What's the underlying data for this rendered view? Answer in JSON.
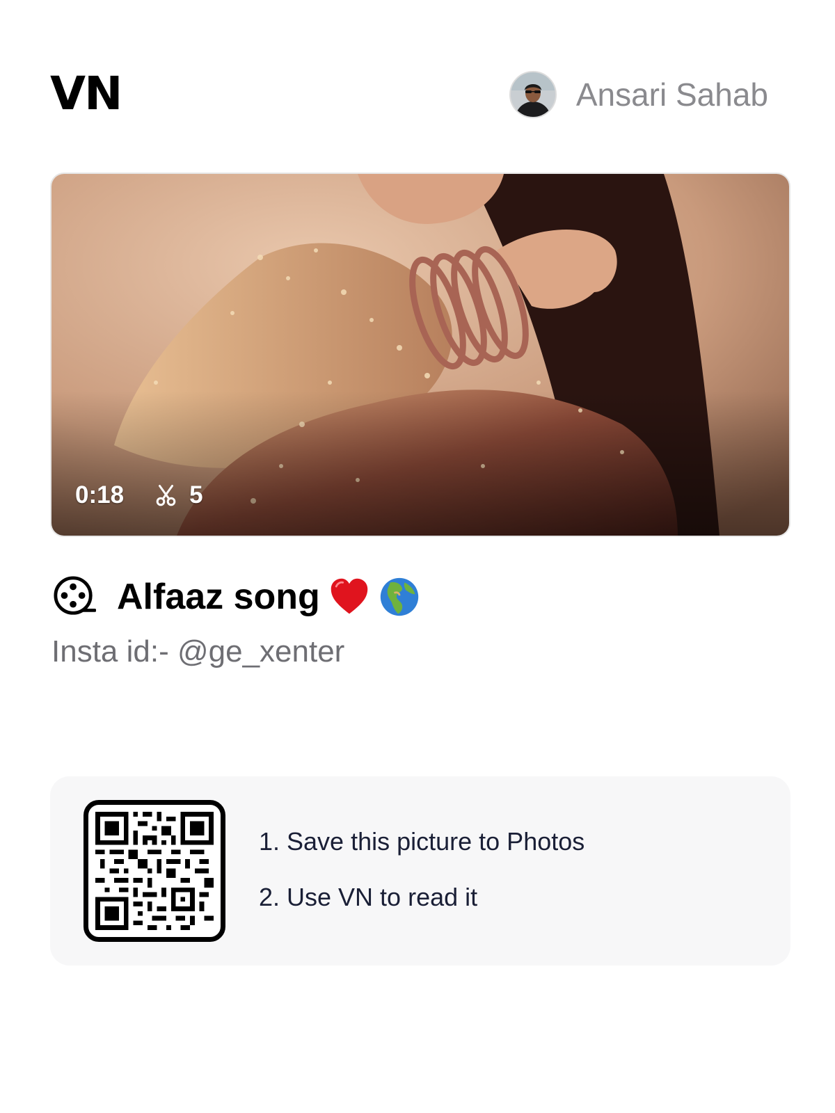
{
  "header": {
    "logo_text": "VN",
    "author_name": "Ansari Sahab",
    "avatar_icon": "profile-photo"
  },
  "video": {
    "duration": "0:18",
    "clip_count": "5",
    "clip_icon": "scissors-icon"
  },
  "project": {
    "title": "Alfaaz song",
    "title_icon": "film-reel-icon",
    "emojis": [
      "red-heart",
      "globe-europe-africa"
    ],
    "subtitle": "Insta id:- @ge_xenter"
  },
  "qr_card": {
    "steps": [
      "1. Save this picture to Photos",
      "2. Use VN to read it"
    ]
  },
  "colors": {
    "background": "#ffffff",
    "author_text": "#8a8a8e",
    "subtitle_text": "#6e6e73",
    "card_bg": "#f7f7f8",
    "step_text": "#1a1f36"
  }
}
